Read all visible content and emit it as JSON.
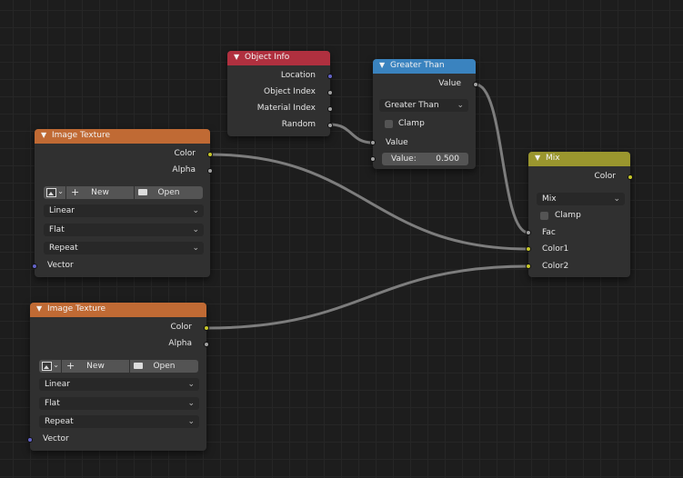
{
  "colors": {
    "object_info_header": "#b0303f",
    "greater_than_header": "#3a83bf",
    "image_texture_header": "#c06a34",
    "mix_header": "#9a962e",
    "wire": "#7d7d7d"
  },
  "object_info": {
    "title": "Object Info",
    "outputs": [
      "Location",
      "Object Index",
      "Material Index",
      "Random"
    ]
  },
  "greater_than": {
    "title": "Greater Than",
    "output": "Value",
    "operation": "Greater Than",
    "clamp": "Clamp",
    "input_label": "Value",
    "value_label": "Value:",
    "value": "0.500"
  },
  "image_texture_1": {
    "title": "Image Texture",
    "outputs": [
      "Color",
      "Alpha"
    ],
    "new_label": "New",
    "open_label": "Open",
    "interpolation": "Linear",
    "projection": "Flat",
    "extension": "Repeat",
    "vector_label": "Vector"
  },
  "image_texture_2": {
    "title": "Image Texture",
    "outputs": [
      "Color",
      "Alpha"
    ],
    "new_label": "New",
    "open_label": "Open",
    "interpolation": "Linear",
    "projection": "Flat",
    "extension": "Repeat",
    "vector_label": "Vector"
  },
  "mix": {
    "title": "Mix",
    "output": "Color",
    "blend_type": "Mix",
    "clamp": "Clamp",
    "inputs": [
      "Fac",
      "Color1",
      "Color2"
    ]
  }
}
